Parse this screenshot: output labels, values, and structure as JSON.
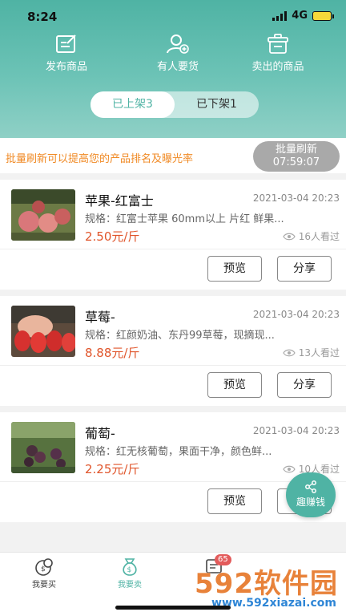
{
  "status_bar": {
    "time": "8:24",
    "network": "4G"
  },
  "top_actions": [
    {
      "label": "发布商品",
      "icon": "edit-icon"
    },
    {
      "label": "有人要货",
      "icon": "user-add-icon"
    },
    {
      "label": "卖出的商品",
      "icon": "box-icon"
    }
  ],
  "segment": {
    "listed": "已上架3",
    "delisted": "已下架1",
    "active": "listed"
  },
  "notice": {
    "text": "批量刷新可以提高您的产品排名及曝光率",
    "refresh_label": "批量刷新",
    "countdown": "07:59:07"
  },
  "products": [
    {
      "title": "苹果-红富士",
      "date": "2021-03-04 20:23",
      "spec": "规格：红富士苹果 60mm以上 片红 鲜果...",
      "price": "2.50元/斤",
      "views": "16人看过",
      "thumb": "apples"
    },
    {
      "title": "草莓-",
      "date": "2021-03-04 20:23",
      "spec": "规格：红颜奶油、东丹99草莓，现摘现...",
      "price": "8.88元/斤",
      "views": "13人看过",
      "thumb": "strawberries"
    },
    {
      "title": "葡萄-",
      "date": "2021-03-04 20:23",
      "spec": "规格：红无核葡萄，果面干净，颜色鲜...",
      "price": "2.25元/斤",
      "views": "10人看过",
      "thumb": "grapes"
    }
  ],
  "buttons": {
    "preview": "预览",
    "share": "分享"
  },
  "float_button": {
    "label": "趣赚钱",
    "icon": "share-icon"
  },
  "tabbar": [
    {
      "label": "我要买",
      "icon": "buy-icon"
    },
    {
      "label": "我要卖",
      "icon": "sell-icon",
      "active": true
    },
    {
      "label": "",
      "icon": "message-icon",
      "badge": "65"
    }
  ],
  "watermark": {
    "brand": "592软件园",
    "url": "www.592xiazai.com"
  },
  "colors": {
    "accent": "#4fb3a4",
    "price": "#e0552b",
    "notice": "#f08a25"
  }
}
